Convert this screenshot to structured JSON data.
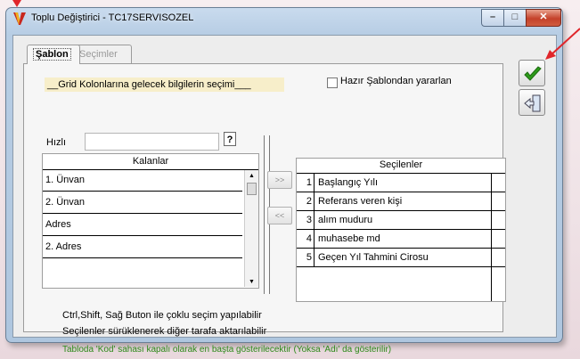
{
  "window": {
    "title": "Toplu Değiştirici - TC17SERVISOZEL",
    "controls": {
      "minimize": "–",
      "maximize": "□",
      "close": "✕"
    }
  },
  "tabs": [
    {
      "label": "Şablon",
      "active": true
    },
    {
      "label": "Seçimler",
      "active": false
    }
  ],
  "panel": {
    "grid_label": "__Grid Kolonlarına gelecek bilgilerin seçimi___",
    "hazir_checkbox": {
      "label": "Hazır Şablondan yararlan",
      "checked": false
    },
    "hizli": {
      "label": "Hızlı",
      "value": "",
      "help": "?"
    }
  },
  "kalanlar": {
    "header": "Kalanlar",
    "rows": [
      "1. Ünvan",
      "2. Ünvan",
      "Adres",
      "2. Adres"
    ]
  },
  "move_buttons": {
    "right": ">>",
    "left": "<<"
  },
  "secilenler": {
    "header": "Seçilenler",
    "rows": [
      {
        "no": "1",
        "text": "Başlangıç Yılı"
      },
      {
        "no": "2",
        "text": "Referans veren kişi"
      },
      {
        "no": "3",
        "text": "alım muduru"
      },
      {
        "no": "4",
        "text": "muhasebe md"
      },
      {
        "no": "5",
        "text": "Geçen Yıl Tahmini Cirosu"
      }
    ]
  },
  "info": {
    "line1": "Ctrl,Shift, Sağ Buton ile çoklu seçim yapılabilir",
    "line2": "Seçilenler sürüklenerek diğer tarafa aktarılabilir",
    "line3": "Tabloda 'Kod' sahası kapalı olarak en başta gösterilecektir (Yoksa 'Adı' da gösterilir)"
  },
  "colors": {
    "accent_green": "#2d8a1a",
    "annotation_red": "#e0262b",
    "label_highlight": "#f7eeca"
  }
}
